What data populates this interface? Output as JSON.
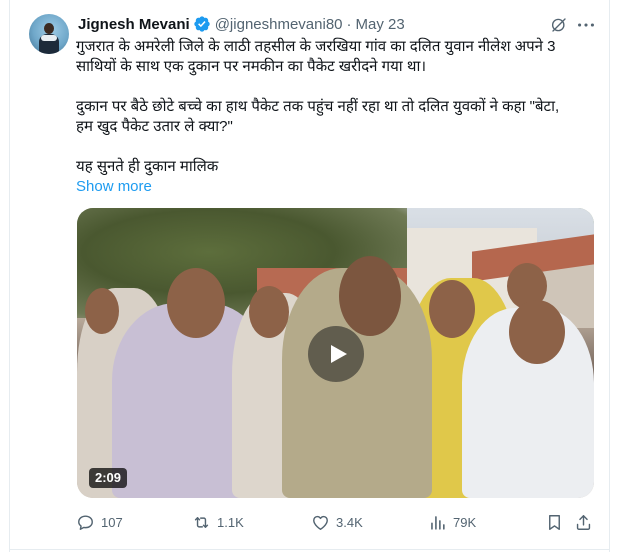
{
  "tweet": {
    "author_name": "Jignesh Mevani",
    "handle": "@jigneshmevani80",
    "separator": "·",
    "date": "May 23",
    "lines": [
      "गुजरात के अमरेली जिले के लाठी तहसील के जरखिया गांव का दलित युवान नीलेश अपने 3",
      "साथियों के साथ एक दुकान पर नमकीन का पैकेट खरीदने गया था।",
      "दुकान पर बैठे छोटे बच्चे का हाथ पैकेट तक पहुंच नहीं रहा था तो दलित युवकों ने कहा \"बेटा,",
      "हम खुद पैकेट उतार ले क्या?\"",
      "यह सुनते ही दुकान मालिक"
    ],
    "show_more": "Show more",
    "video": {
      "duration": "2:09"
    },
    "actions": {
      "replies": "107",
      "reposts": "1.1K",
      "likes": "3.4K",
      "views": "79K"
    }
  },
  "colors": {
    "accent": "#1d9bf0",
    "secondary_text": "#536471",
    "primary_text": "#0f1419"
  },
  "icons": [
    "verified-badge-icon",
    "grok-icon",
    "more-icon",
    "play-icon",
    "reply-icon",
    "repost-icon",
    "like-icon",
    "views-icon",
    "bookmark-icon",
    "share-icon"
  ]
}
